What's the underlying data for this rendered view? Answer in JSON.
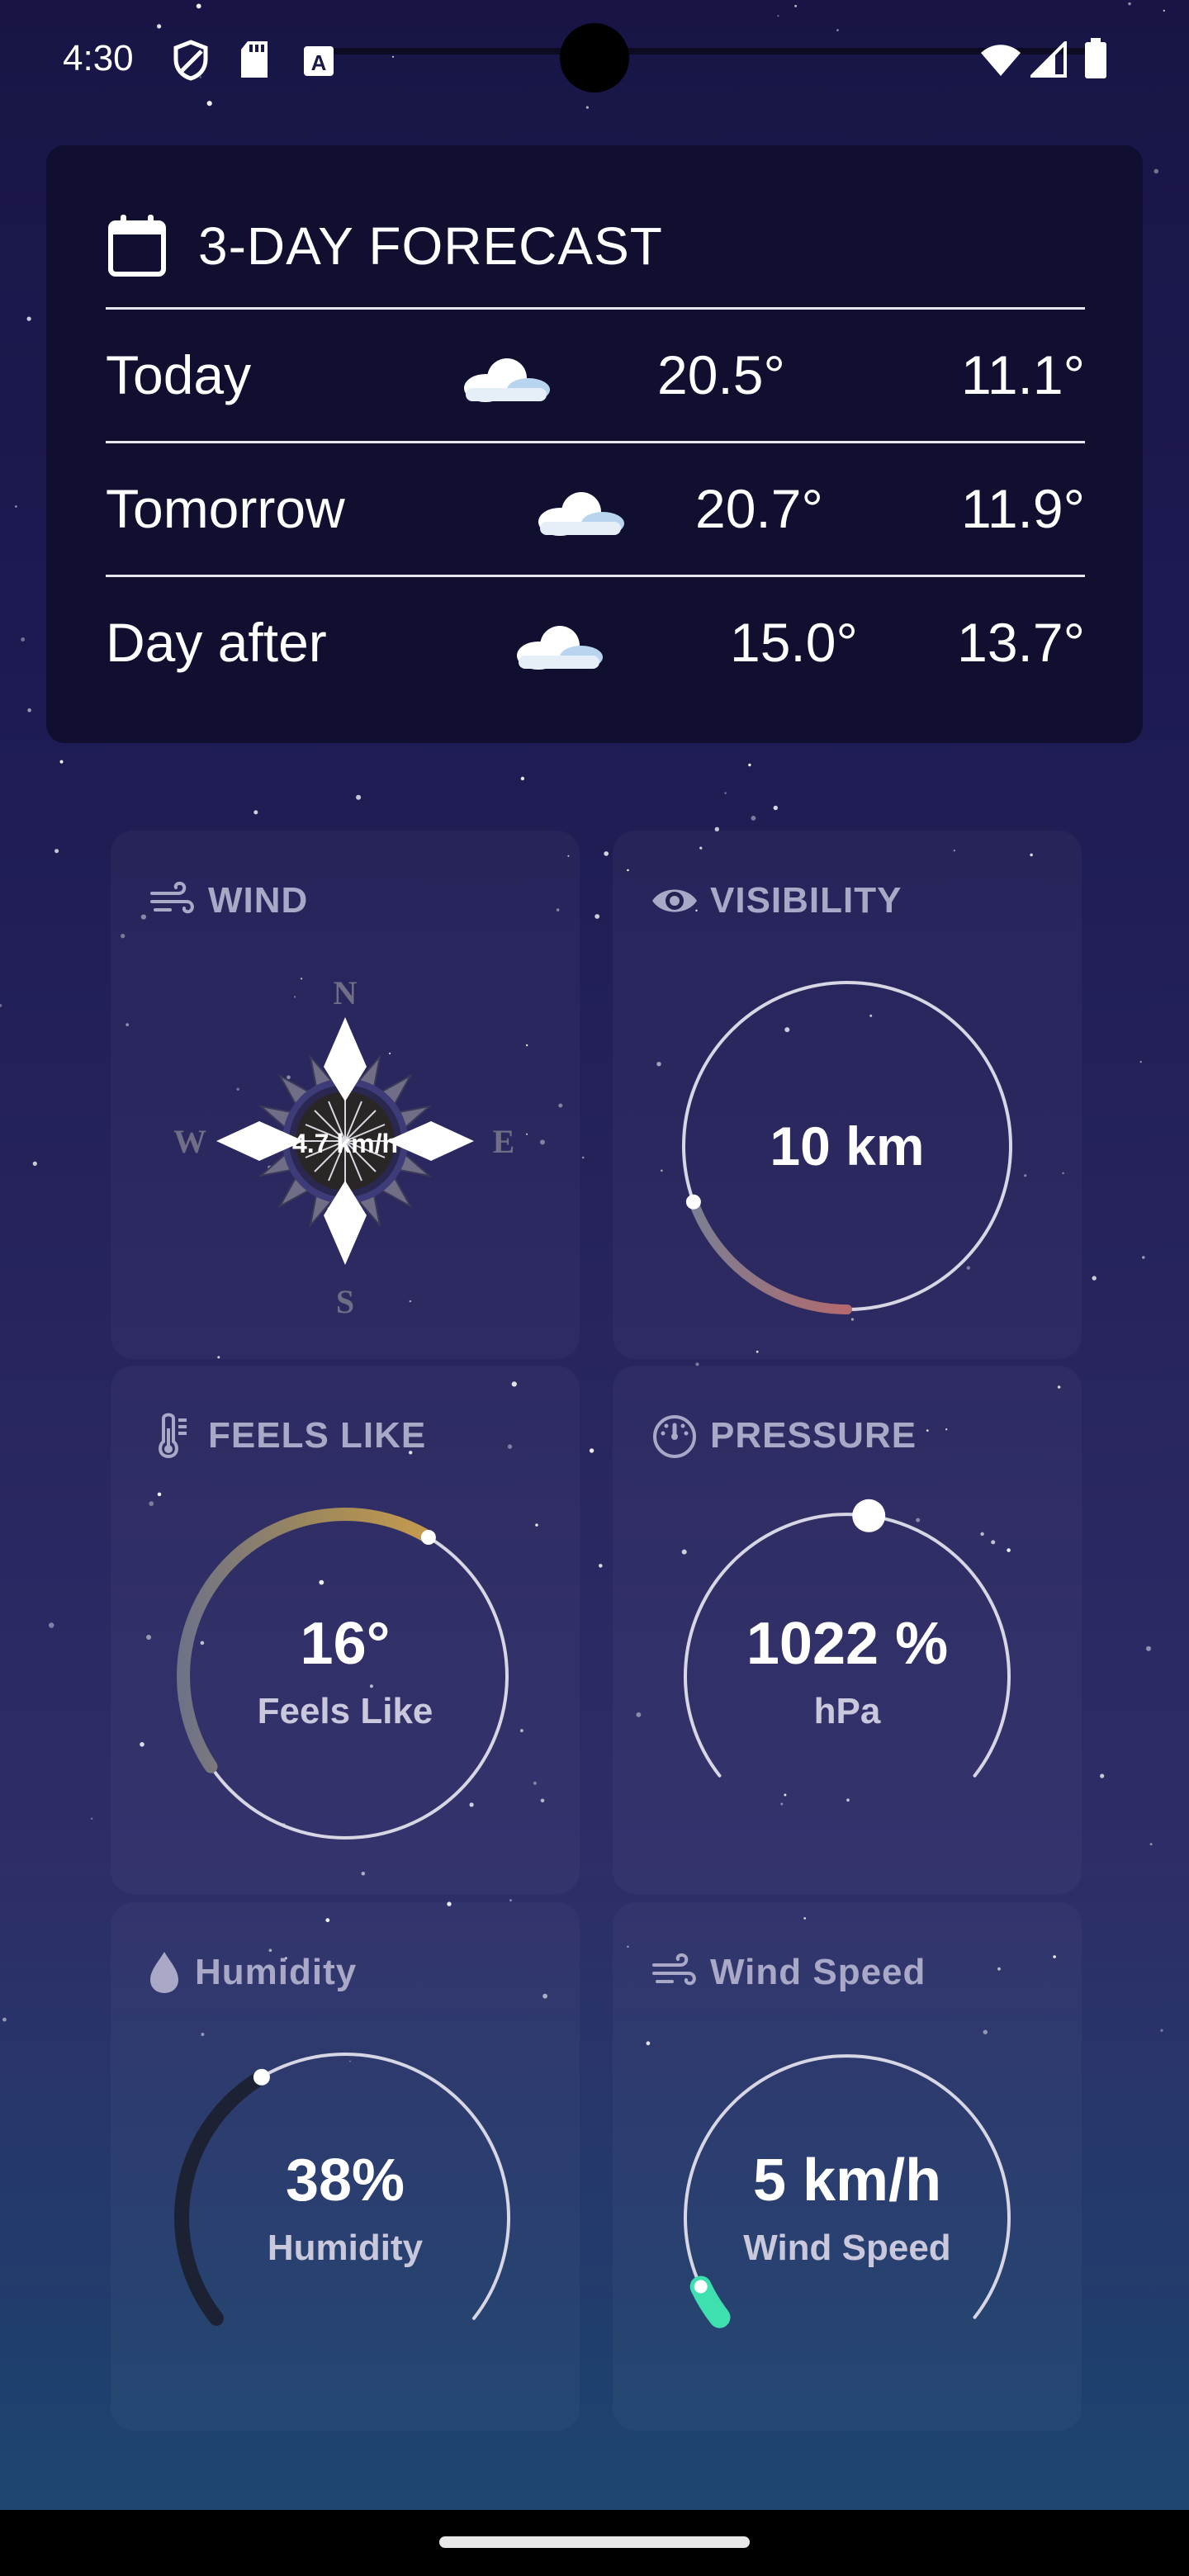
{
  "status_bar": {
    "time": "4:30",
    "icons": [
      "shield-icon",
      "sd-card-icon",
      "font-a-icon",
      "wifi-icon",
      "signal-icon",
      "battery-icon"
    ]
  },
  "forecast": {
    "title": "3-DAY FORECAST",
    "icon": "calendar-icon",
    "days": [
      {
        "day": "Today",
        "icon": "cloud-icon",
        "high": "20.5°",
        "low": "11.1°"
      },
      {
        "day": "Tomorrow",
        "icon": "cloud-icon",
        "high": "20.7°",
        "low": "11.9°"
      },
      {
        "day": "Day after",
        "icon": "cloud-icon",
        "high": "15.0°",
        "low": "13.7°"
      }
    ]
  },
  "wind": {
    "label": "WIND",
    "icon": "wind-icon",
    "speed": "4.7 km/h",
    "compass": {
      "n": "N",
      "e": "E",
      "s": "S",
      "w": "W"
    }
  },
  "visibility": {
    "label": "VISIBILITY",
    "icon": "eye-icon",
    "value": "10 km",
    "level_fraction": 0.25
  },
  "feels_like": {
    "label": "FEELS LIKE",
    "icon": "thermometer-icon",
    "value": "16°",
    "sub": "Feels Like",
    "level_fraction": 0.62
  },
  "pressure": {
    "label": "PRESSURE",
    "icon": "gauge-icon",
    "value": "1022 %",
    "sub": "hPa",
    "level_fraction": 0.53
  },
  "humidity": {
    "label": "Humidity",
    "icon": "droplet-icon",
    "value": "38%",
    "sub": "Humidity",
    "level_fraction": 0.38
  },
  "wind_speed": {
    "label": "Wind Speed",
    "icon": "wind-icon",
    "value": "5 km/h",
    "sub": "Wind Speed",
    "level_fraction": 0.05
  },
  "colors": {
    "card": "#100f30",
    "tile_label": "#a9a8c6",
    "feels_arc": "#c59a4e",
    "visibility_arc": "#b36a6e",
    "wind_speed_arc": "#3ee0b0",
    "humidity_arc": "#1c2233"
  }
}
